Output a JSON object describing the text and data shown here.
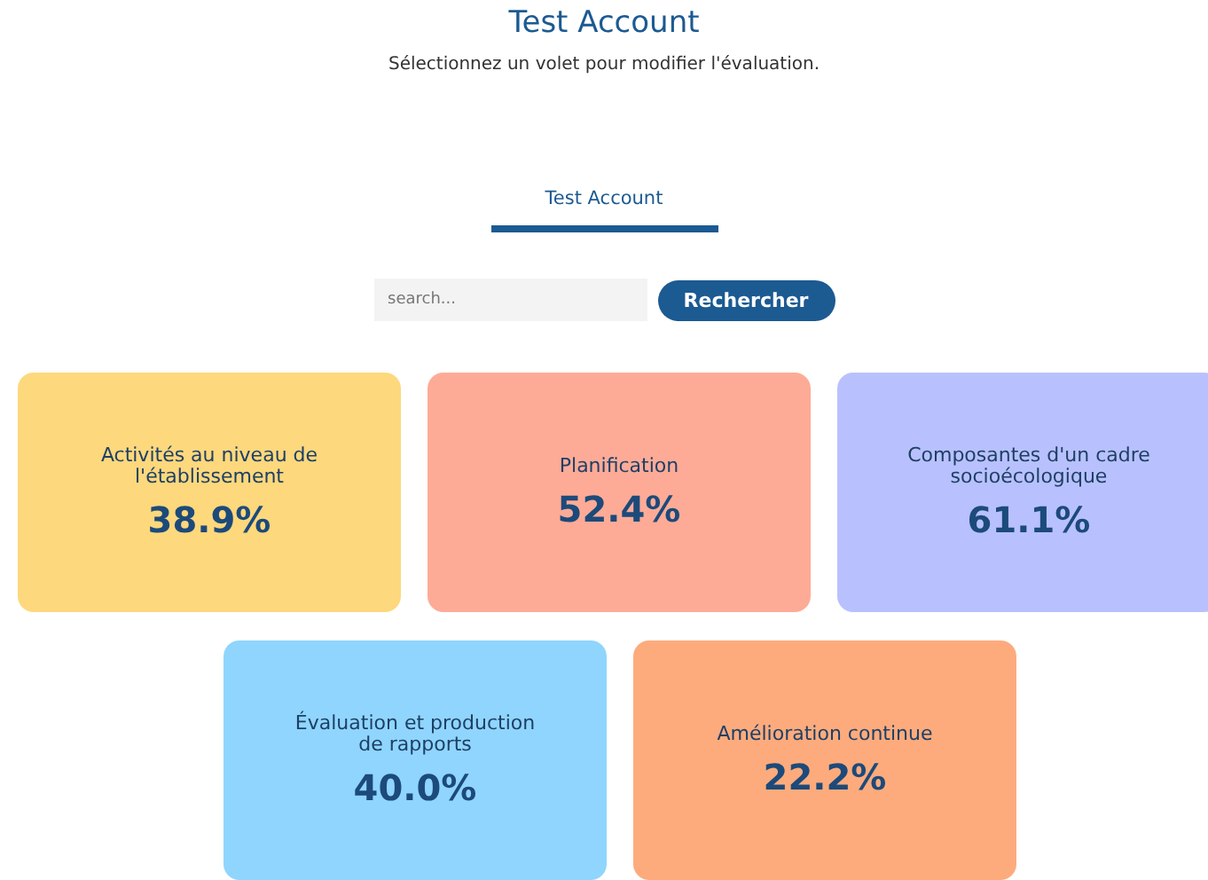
{
  "account_title": "Test Account",
  "instruction": "Sélectionnez un volet pour modifier l'évaluation.",
  "tabs": [
    {
      "label": "Test Account",
      "selected": true
    }
  ],
  "search": {
    "placeholder": "search...",
    "button": "Rechercher"
  },
  "cards": [
    {
      "title": "Activités au niveau de l'établissement",
      "score": "38.9%",
      "color": "#fdd87c"
    },
    {
      "title": "Planification",
      "score": "52.4%",
      "color": "#fdab97"
    },
    {
      "title": "Composantes d'un cadre socioécologique",
      "score": "61.1%",
      "color": "#b8c1fd"
    },
    {
      "title": "Évaluation et production de rapports",
      "score": "40.0%",
      "color": "#8fd5fd"
    },
    {
      "title": "Amélioration continue",
      "score": "22.2%",
      "color": "#fdab7c"
    }
  ]
}
